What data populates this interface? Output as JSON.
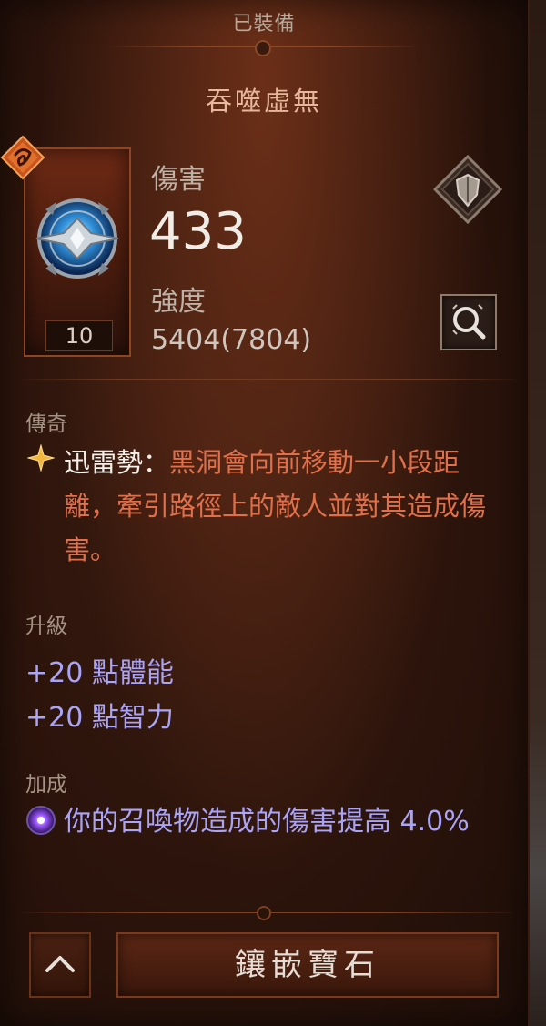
{
  "header": {
    "status": "已裝備",
    "item_name": "吞噬虛無"
  },
  "aspect": {
    "level": "10",
    "emblem_icon": "class-emblem-icon",
    "item_icon": "glyph-orb-icon"
  },
  "stats": {
    "primary_label": "傷害",
    "primary_value": "433",
    "secondary_label": "強度",
    "secondary_value": "5404(7804)"
  },
  "actions": {
    "shield_icon": "shield-icon",
    "inspect_icon": "magnifier-icon",
    "collapse_icon": "chevron-up-icon",
    "socket_label": "鑲嵌寶石"
  },
  "legendary": {
    "title": "傳奇",
    "power_name": "迅雷勢：",
    "power_desc": "黑洞會向前移動一小段距離，牽引路徑上的敵人並對其造成傷害。"
  },
  "upgrade": {
    "title": "升級",
    "lines": [
      "+20 點體能",
      "+20 點智力"
    ]
  },
  "bonus": {
    "title": "加成",
    "text": "你的召喚物造成的傷害提高 4.0%"
  },
  "colors": {
    "legendary_text": "#e0704b",
    "upgrade_text": "#aba4f5",
    "title_text": "#e6b79a"
  }
}
